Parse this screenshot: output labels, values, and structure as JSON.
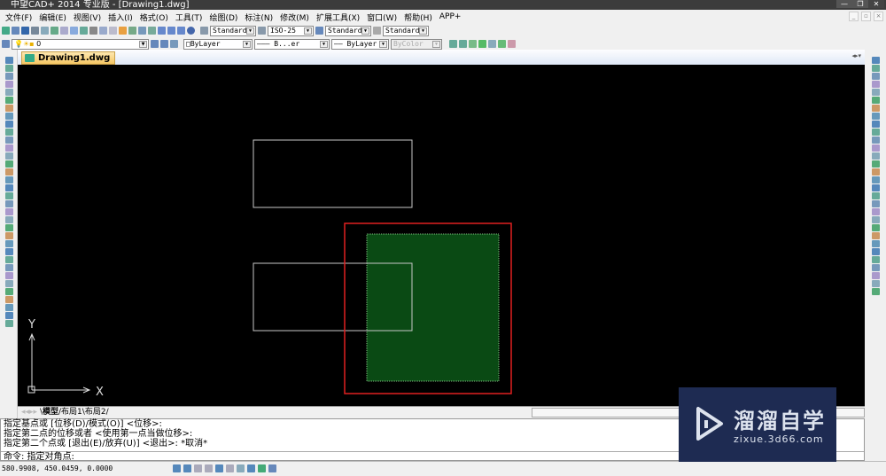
{
  "window": {
    "title": "中望CAD+ 2014 专业版 - [Drawing1.dwg]",
    "minimize": "—",
    "restore": "❐",
    "close": "✕"
  },
  "menu": [
    "文件(F)",
    "编辑(E)",
    "视图(V)",
    "插入(I)",
    "格式(O)",
    "工具(T)",
    "绘图(D)",
    "标注(N)",
    "修改(M)",
    "扩展工具(X)",
    "窗口(W)",
    "帮助(H)",
    "APP+"
  ],
  "toolbar": {
    "text_style": "Standard",
    "dim_style": "ISO-25",
    "table_style": "Standard",
    "multileader_style": "Standard",
    "layer": "0",
    "color": "ByLayer",
    "linetype": "B...er",
    "lineweight": "ByLayer",
    "plot_style": "ByColor"
  },
  "document_tab": "Drawing1.dwg",
  "ucs": {
    "x_label": "X",
    "y_label": "Y"
  },
  "layout_tabs": [
    "模型",
    "布局1",
    "布局2"
  ],
  "command_history": [
    "指定基点或 [位移(D)/模式(O)] <位移>:",
    "指定第二点的位移或者 <使用第一点当做位移>:",
    "指定第二个点或 [退出(E)/放弃(U)] <退出>: *取消*"
  ],
  "command_prompt": "命令: 指定对角点:",
  "coordinates": "580.9908,  450.0459,  0.0000",
  "watermark": {
    "name": "溜溜自学",
    "url": "zixue.3d66.com"
  },
  "colors": {
    "selection": "#e02020",
    "hatch": "#0a4a14",
    "canvas": "#000000"
  }
}
